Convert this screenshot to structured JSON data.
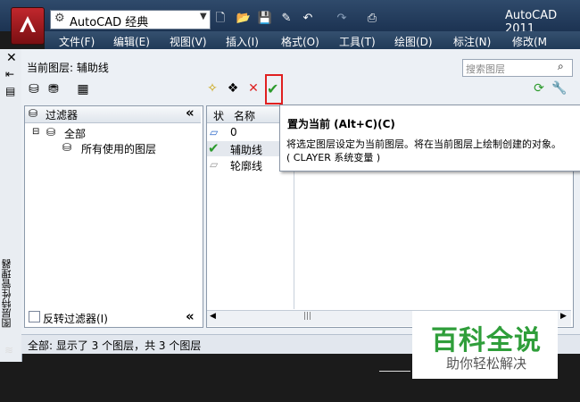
{
  "titlebar": {
    "workspace": "AutoCAD 经典",
    "app_title": "AutoCAD 2011"
  },
  "menu": [
    "文件(F)",
    "编辑(E)",
    "视图(V)",
    "插入(I)",
    "格式(O)",
    "工具(T)",
    "绘图(D)",
    "标注(N)",
    "修改(M"
  ],
  "palette": {
    "vertical_title": "图层特性管理器",
    "current_layer": "当前图层: 辅助线",
    "search_placeholder": "搜索图层"
  },
  "filters": {
    "header": "过滤器",
    "collapse": "«",
    "root": "全部",
    "child": "所有使用的图层",
    "invert_label": "反转过滤器(I)"
  },
  "layers": {
    "col_status": "状",
    "col_name": "名称",
    "rows": [
      {
        "name": "0",
        "current": false
      },
      {
        "name": "辅助线",
        "current": true
      },
      {
        "name": "轮廓线",
        "current": false
      }
    ]
  },
  "tooltip": {
    "title": "置为当前 (Alt+C)(C)",
    "desc": "将选定图层设定为当前图层。将在当前图层上绘制创建的对象。",
    "note": "( CLAYER 系统变量 )"
  },
  "status": "全部: 显示了 3 个图层，共 3 个图层",
  "watermark": {
    "title": "百科全说",
    "subtitle": "助你轻松解决"
  },
  "colors": {
    "accent_red": "#e02020",
    "check_green": "#2c9a2c",
    "watermark_green": "#2f9e3a"
  }
}
